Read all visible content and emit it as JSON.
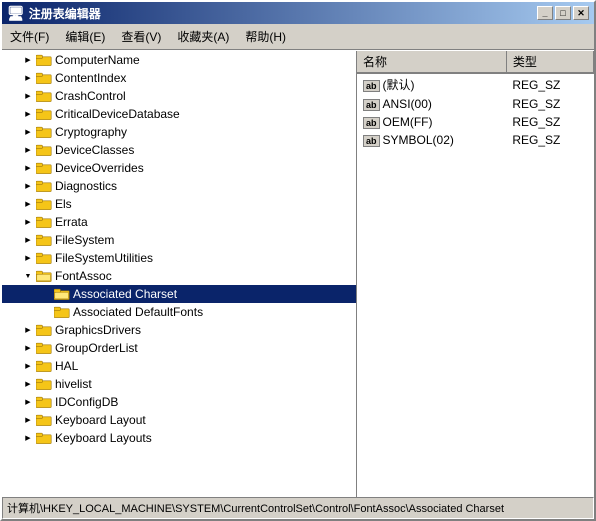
{
  "window": {
    "title": "注册表编辑器",
    "icon": "🖥",
    "buttons": [
      "_",
      "□",
      "✕"
    ]
  },
  "menu": {
    "items": [
      "文件(F)",
      "编辑(E)",
      "查看(V)",
      "收藏夹(A)",
      "帮助(H)"
    ]
  },
  "tree": {
    "items": [
      {
        "id": "ComputerName",
        "label": "ComputerName",
        "level": 1,
        "state": "collapsed"
      },
      {
        "id": "ContentIndex",
        "label": "ContentIndex",
        "level": 1,
        "state": "collapsed"
      },
      {
        "id": "CrashControl",
        "label": "CrashControl",
        "level": 1,
        "state": "collapsed"
      },
      {
        "id": "CriticalDeviceDatabase",
        "label": "CriticalDeviceDatabase",
        "level": 1,
        "state": "collapsed"
      },
      {
        "id": "Cryptography",
        "label": "Cryptography",
        "level": 1,
        "state": "collapsed"
      },
      {
        "id": "DeviceClasses",
        "label": "DeviceClasses",
        "level": 1,
        "state": "collapsed"
      },
      {
        "id": "DeviceOverrides",
        "label": "DeviceOverrides",
        "level": 1,
        "state": "collapsed"
      },
      {
        "id": "Diagnostics",
        "label": "Diagnostics",
        "level": 1,
        "state": "collapsed"
      },
      {
        "id": "Els",
        "label": "Els",
        "level": 1,
        "state": "collapsed"
      },
      {
        "id": "Errata",
        "label": "Errata",
        "level": 1,
        "state": "collapsed"
      },
      {
        "id": "FileSystem",
        "label": "FileSystem",
        "level": 1,
        "state": "collapsed"
      },
      {
        "id": "FileSystemUtilities",
        "label": "FileSystemUtilities",
        "level": 1,
        "state": "collapsed"
      },
      {
        "id": "FontAssoc",
        "label": "FontAssoc",
        "level": 1,
        "state": "expanded"
      },
      {
        "id": "AssociatedCharset",
        "label": "Associated Charset",
        "level": 2,
        "state": "none",
        "selected": true
      },
      {
        "id": "AssociatedDefaultFonts",
        "label": "Associated DefaultFonts",
        "level": 2,
        "state": "none"
      },
      {
        "id": "GraphicsDrivers",
        "label": "GraphicsDrivers",
        "level": 1,
        "state": "collapsed"
      },
      {
        "id": "GroupOrderList",
        "label": "GroupOrderList",
        "level": 1,
        "state": "collapsed"
      },
      {
        "id": "HAL",
        "label": "HAL",
        "level": 1,
        "state": "collapsed"
      },
      {
        "id": "hivelist",
        "label": "hivelist",
        "level": 1,
        "state": "collapsed"
      },
      {
        "id": "IDConfigDB",
        "label": "IDConfigDB",
        "level": 1,
        "state": "collapsed"
      },
      {
        "id": "KeyboardLayout",
        "label": "Keyboard Layout",
        "level": 1,
        "state": "collapsed"
      },
      {
        "id": "KeyboardLayouts",
        "label": "Keyboard Layouts",
        "level": 1,
        "state": "collapsed"
      }
    ]
  },
  "registry": {
    "columns": [
      "名称",
      "类型"
    ],
    "rows": [
      {
        "icon": "ab",
        "name": "(默认)",
        "type": "REG_SZ"
      },
      {
        "icon": "ab",
        "name": "ANSI(00)",
        "type": "REG_SZ"
      },
      {
        "icon": "ab",
        "name": "OEM(FF)",
        "type": "REG_SZ"
      },
      {
        "icon": "ab",
        "name": "SYMBOL(02)",
        "type": "REG_SZ"
      }
    ]
  },
  "statusbar": {
    "text": "计算机\\HKEY_LOCAL_MACHINE\\SYSTEM\\CurrentControlSet\\Control\\FontAssoc\\Associated Charset"
  }
}
